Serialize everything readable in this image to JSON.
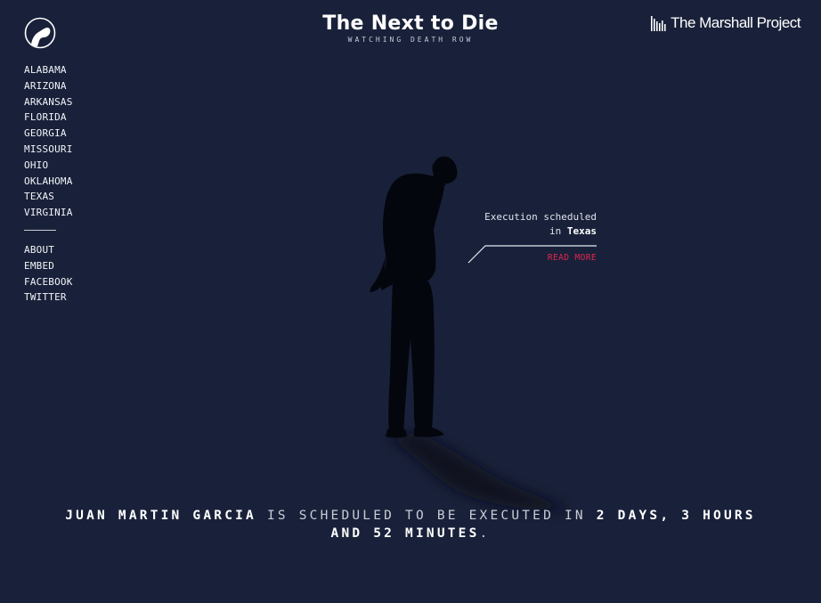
{
  "header": {
    "title": "The Next to Die",
    "subtitle": "WATCHING DEATH ROW",
    "brand_name": "The Marshall Project"
  },
  "icons": {
    "logo": "bowed-head-logo-icon",
    "brand": "marshall-project-bars-icon"
  },
  "sidebar": {
    "states": [
      "ALABAMA",
      "ARIZONA",
      "ARKANSAS",
      "FLORIDA",
      "GEORGIA",
      "MISSOURI",
      "OHIO",
      "OKLAHOMA",
      "TEXAS",
      "VIRGINIA"
    ],
    "links": [
      "ABOUT",
      "EMBED",
      "FACEBOOK",
      "TWITTER"
    ]
  },
  "callout": {
    "line1": "Execution scheduled",
    "prefix": "in",
    "state": "Texas",
    "read_more": "READ MORE"
  },
  "countdown": {
    "name": "JUAN MARTIN GARCIA",
    "middle": "IS SCHEDULED TO BE EXECUTED IN",
    "time": "2 DAYS, 3 HOURS AND 52 MINUTES",
    "end": "."
  },
  "colors": {
    "background": "#19213a",
    "accent": "#e0254c",
    "text": "#ffffff"
  }
}
